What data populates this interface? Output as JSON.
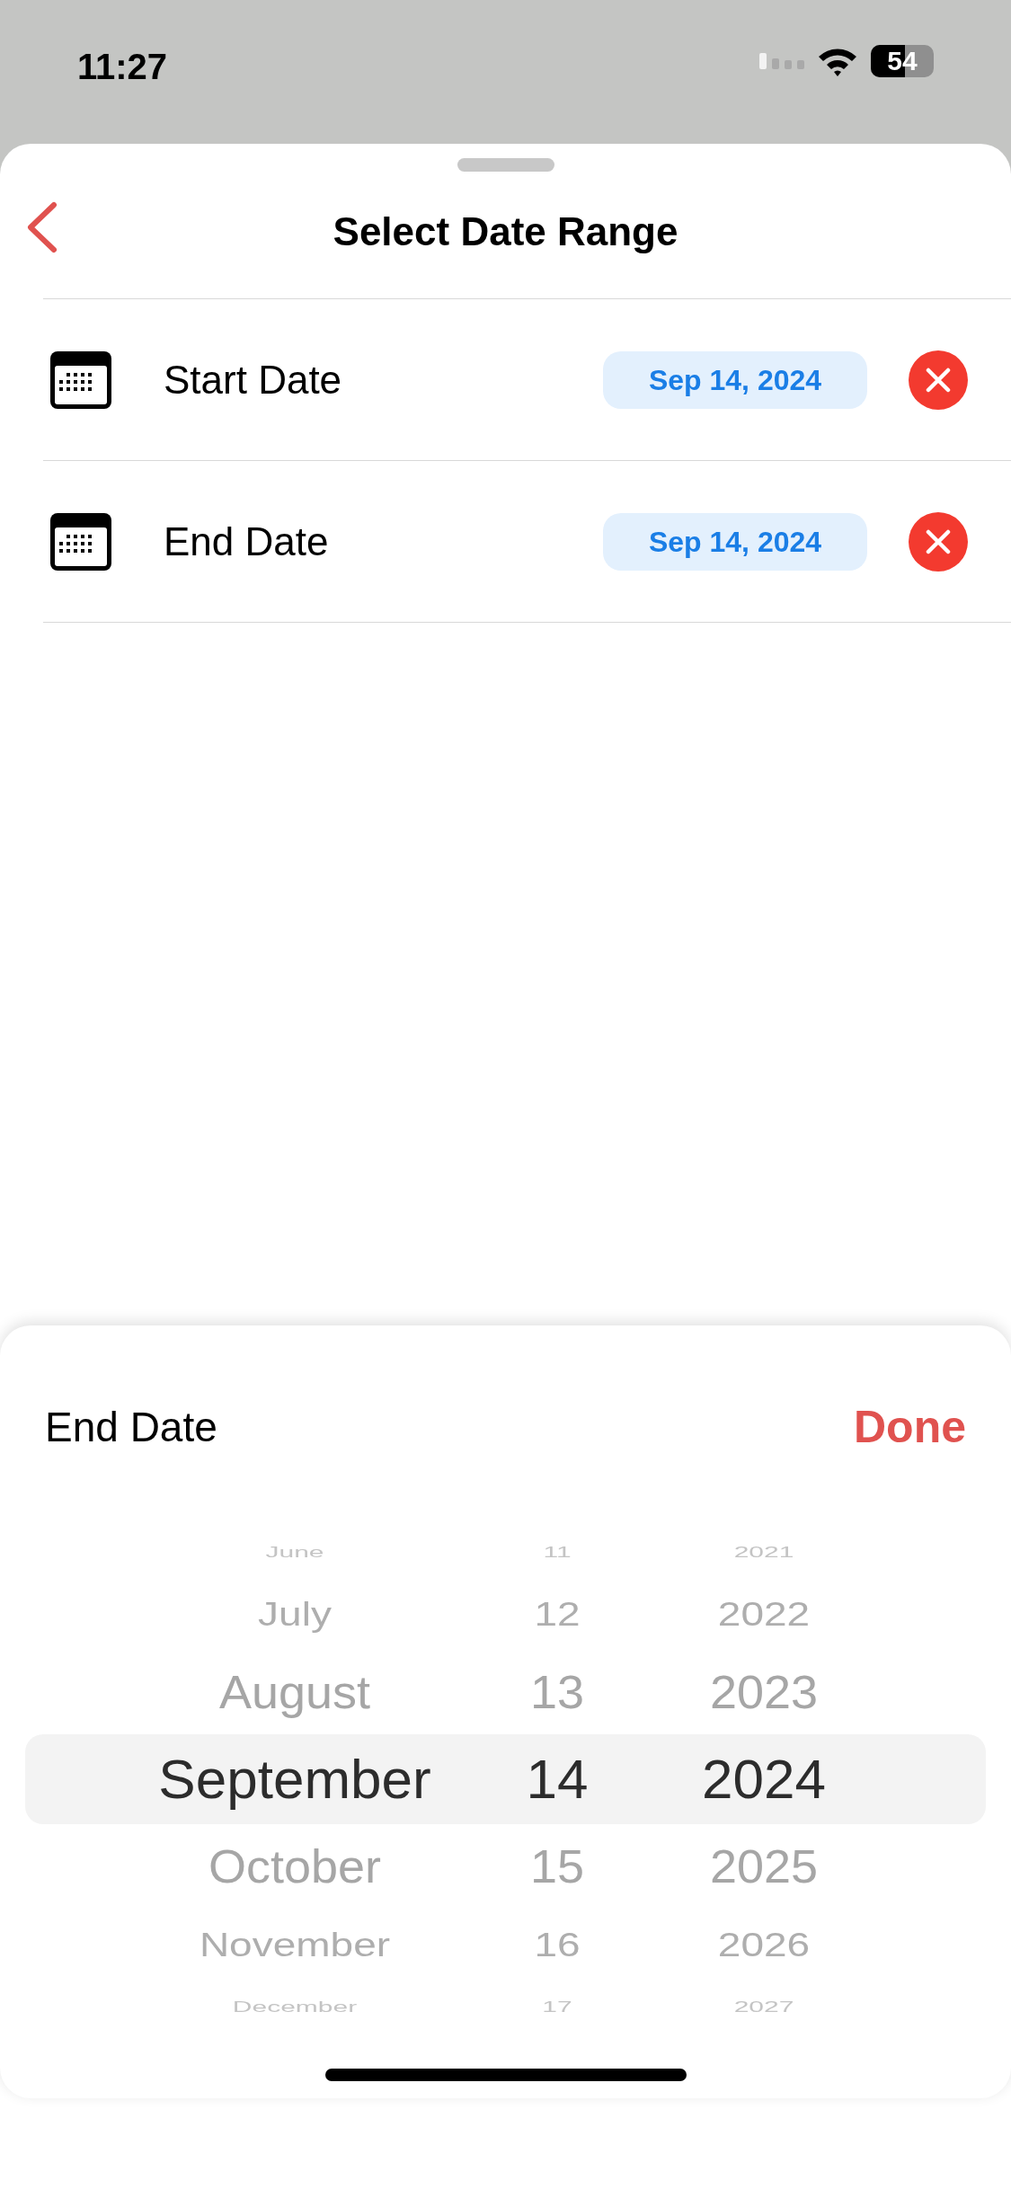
{
  "status_bar": {
    "time": "11:27",
    "battery": "54"
  },
  "header": {
    "title": "Select Date Range"
  },
  "rows": [
    {
      "label": "Start Date",
      "value": "Sep 14, 2024"
    },
    {
      "label": "End Date",
      "value": "Sep 14, 2024"
    }
  ],
  "picker_sheet": {
    "title": "End Date",
    "done": "Done",
    "columns": [
      {
        "items": [
          {
            "label": "June",
            "selected": false
          },
          {
            "label": "July",
            "selected": false
          },
          {
            "label": "August",
            "selected": false
          },
          {
            "label": "September",
            "selected": true
          },
          {
            "label": "October",
            "selected": false
          },
          {
            "label": "November",
            "selected": false
          },
          {
            "label": "December",
            "selected": false
          }
        ]
      },
      {
        "items": [
          {
            "label": "11",
            "selected": false
          },
          {
            "label": "12",
            "selected": false
          },
          {
            "label": "13",
            "selected": false
          },
          {
            "label": "14",
            "selected": true
          },
          {
            "label": "15",
            "selected": false
          },
          {
            "label": "16",
            "selected": false
          },
          {
            "label": "17",
            "selected": false
          }
        ]
      },
      {
        "items": [
          {
            "label": "2021",
            "selected": false
          },
          {
            "label": "2022",
            "selected": false
          },
          {
            "label": "2023",
            "selected": false
          },
          {
            "label": "2024",
            "selected": true
          },
          {
            "label": "2025",
            "selected": false
          },
          {
            "label": "2026",
            "selected": false
          },
          {
            "label": "2027",
            "selected": false
          }
        ]
      }
    ]
  }
}
